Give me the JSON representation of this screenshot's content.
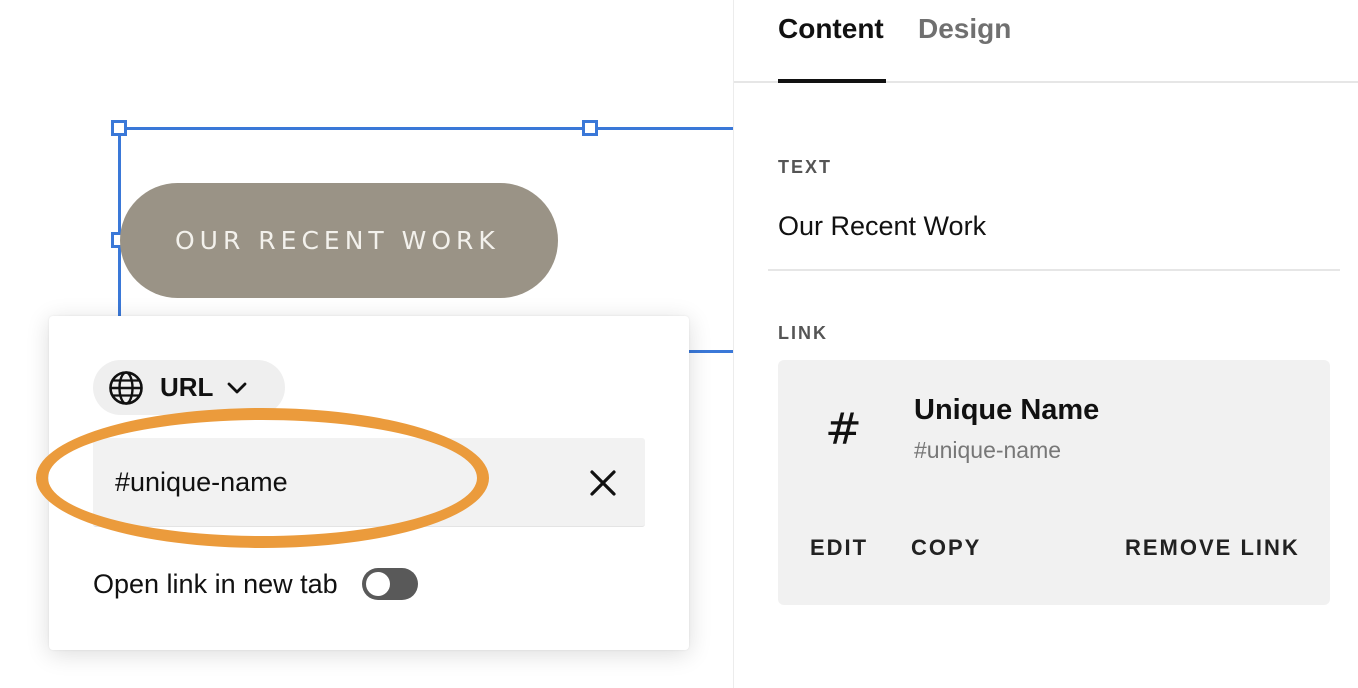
{
  "canvas": {
    "button_text": "OUR RECENT WORK"
  },
  "link_popover": {
    "link_type": "URL",
    "url_value": "#unique-name",
    "open_new_tab_label": "Open link in new tab",
    "open_new_tab_enabled": false,
    "icons": {
      "type": "globe-icon",
      "dropdown": "chevron-down-icon",
      "clear": "close-icon"
    }
  },
  "panel": {
    "tabs": [
      {
        "label": "Content",
        "active": true
      },
      {
        "label": "Design",
        "active": false
      }
    ],
    "text_section": {
      "label": "TEXT",
      "value": "Our Recent Work"
    },
    "link_section": {
      "label": "LINK",
      "icon": "#",
      "name": "Unique Name",
      "anchor": "#unique-name",
      "actions": [
        "EDIT",
        "COPY",
        "REMOVE LINK"
      ]
    }
  },
  "colors": {
    "selection": "#3a78d8",
    "button_bg": "#9a9386",
    "highlight": "#eb9b3c",
    "toggle_off": "#595959"
  }
}
